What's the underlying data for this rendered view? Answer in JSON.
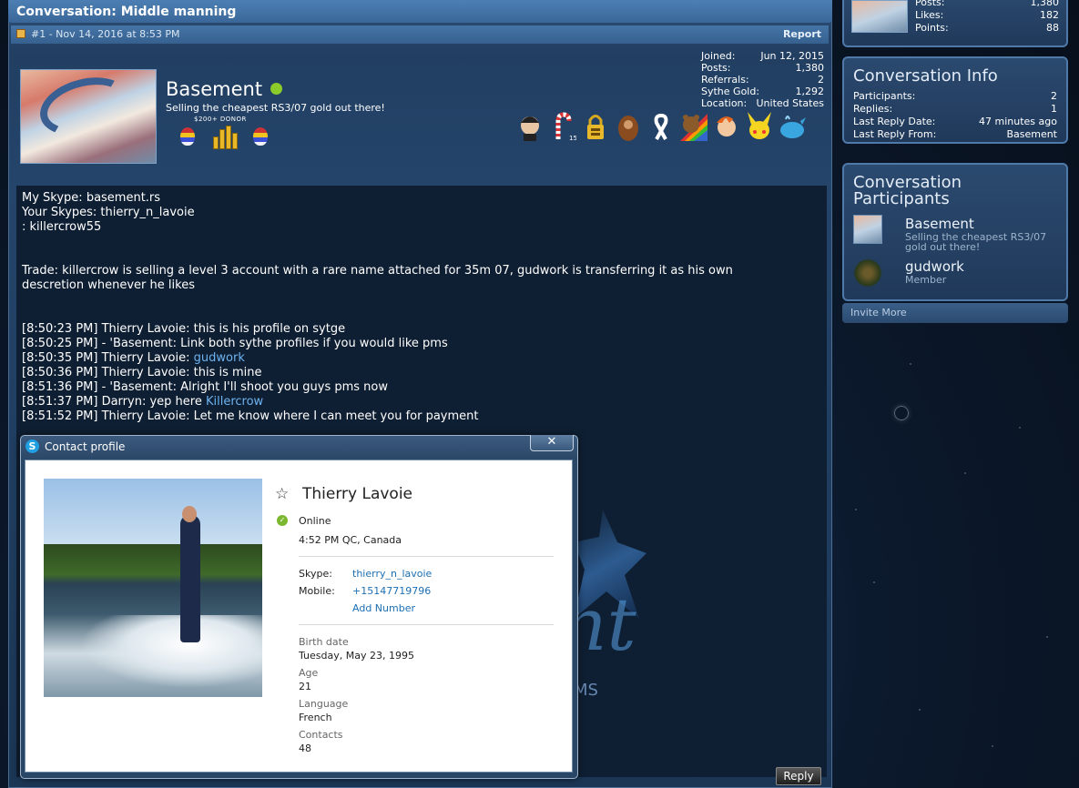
{
  "conversation": {
    "title": "Conversation: Middle manning"
  },
  "post": {
    "header_left": "#1 - Nov 14, 2016 at 8:53 PM",
    "report": "Report",
    "author": {
      "name": "Basement",
      "title": "Selling the cheapest RS3/07 gold out there!",
      "donor_label": "$200+ DONOR",
      "status": "online"
    },
    "stats": [
      {
        "label": "Joined:",
        "value": "Jun 12, 2015"
      },
      {
        "label": "Posts:",
        "value": "1,380"
      },
      {
        "label": "Referrals:",
        "value": "2"
      },
      {
        "label": "Sythe Gold:",
        "value": "1,292"
      },
      {
        "label": "Location:",
        "value": "United States"
      }
    ],
    "trophies": [
      "archer-face-icon",
      "candy-cane-icon",
      "padlock-icon",
      "bigfoot-icon",
      "ribbon-icon",
      "bear-rainbow-icon",
      "fry-face-icon",
      "pikachu-icon",
      "whale-icon"
    ],
    "trophy_subscript": "15",
    "message": {
      "l1": "My Skype: basement.rs",
      "l2": "Your Skypes: thierry_n_lavoie",
      "l3": ": killercrow55",
      "l4": "Trade: killercrow is selling a level 3 account with a rare name attached for 35m 07, gudwork is transferring it as his own",
      "l5": "descretion whenever he likes",
      "chat1": "[8:50:23 PM] Thierry Lavoie: this is his profile on sytge",
      "chat2": "[8:50:25 PM] - 'Basement: Link both sythe profiles if you would like pms",
      "chat3_pre": "[8:50:35 PM] Thierry Lavoie: ",
      "chat3_link": "gudwork",
      "chat4": "[8:50:36 PM] Thierry Lavoie: this is mine",
      "chat5": "[8:51:36 PM] - 'Basement: Alright I'll shoot you guys pms now",
      "chat6_pre": "[8:51:37 PM] Darryn: yep here ",
      "chat6_link": "Killercrow",
      "chat7": "[8:51:52 PM] Thierry Lavoie: Let me know where I can meet you for payment"
    },
    "watermark_ms": "MS",
    "reply": "Reply"
  },
  "sidebar": {
    "top_stats": [
      {
        "label": "Posts:",
        "value": "1,380"
      },
      {
        "label": "Likes:",
        "value": "182"
      },
      {
        "label": "Points:",
        "value": "88"
      }
    ],
    "info": {
      "title": "Conversation Info",
      "rows": [
        {
          "label": "Participants:",
          "value": "2"
        },
        {
          "label": "Replies:",
          "value": "1"
        },
        {
          "label": "Last Reply Date:",
          "value": "47 minutes ago"
        },
        {
          "label": "Last Reply From:",
          "value": "Basement"
        }
      ]
    },
    "participants": {
      "title_line1": "Conversation",
      "title_line2": "Participants",
      "items": [
        {
          "name": "Basement",
          "sub1": "Selling the cheapest RS3/07",
          "sub2": "gold out there!"
        },
        {
          "name": "gudwork",
          "sub1": "Member"
        }
      ]
    },
    "invite": "Invite More"
  },
  "skype_dialog": {
    "title": "Contact profile",
    "close": "✕",
    "name": "Thierry Lavoie",
    "status": "Online",
    "local_time": "4:52 PM QC, Canada",
    "skype_label": "Skype:",
    "skype_value": "thierry_n_lavoie",
    "mobile_label": "Mobile:",
    "mobile_value": "+15147719796",
    "add_number": "Add Number",
    "birth_label": "Birth date",
    "birth_value": "Tuesday, May 23, 1995",
    "age_label": "Age",
    "age_value": "21",
    "language_label": "Language",
    "language_value": "French",
    "contacts_label": "Contacts",
    "contacts_value": "48"
  }
}
